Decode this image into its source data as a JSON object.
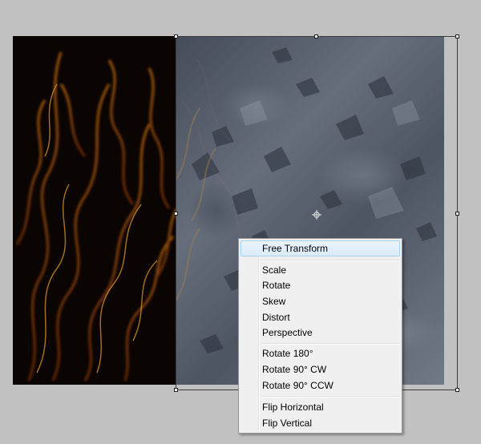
{
  "canvas": {
    "fire_layer_icon": "fire-texture",
    "ice_layer_icon": "ice-texture"
  },
  "context_menu": {
    "items": [
      {
        "label": "Free Transform",
        "highlighted": true
      },
      {
        "label": "Scale"
      },
      {
        "label": "Rotate"
      },
      {
        "label": "Skew"
      },
      {
        "label": "Distort"
      },
      {
        "label": "Perspective"
      },
      {
        "label": "Rotate 180°"
      },
      {
        "label": "Rotate 90° CW"
      },
      {
        "label": "Rotate 90° CCW"
      },
      {
        "label": "Flip Horizontal"
      },
      {
        "label": "Flip Vertical"
      }
    ]
  },
  "colors": {
    "workspace_bg": "#c1c1c1",
    "menu_bg": "#f0f0f0",
    "menu_highlight": "#dcebfa",
    "menu_highlight_border": "#a8d0f2"
  }
}
